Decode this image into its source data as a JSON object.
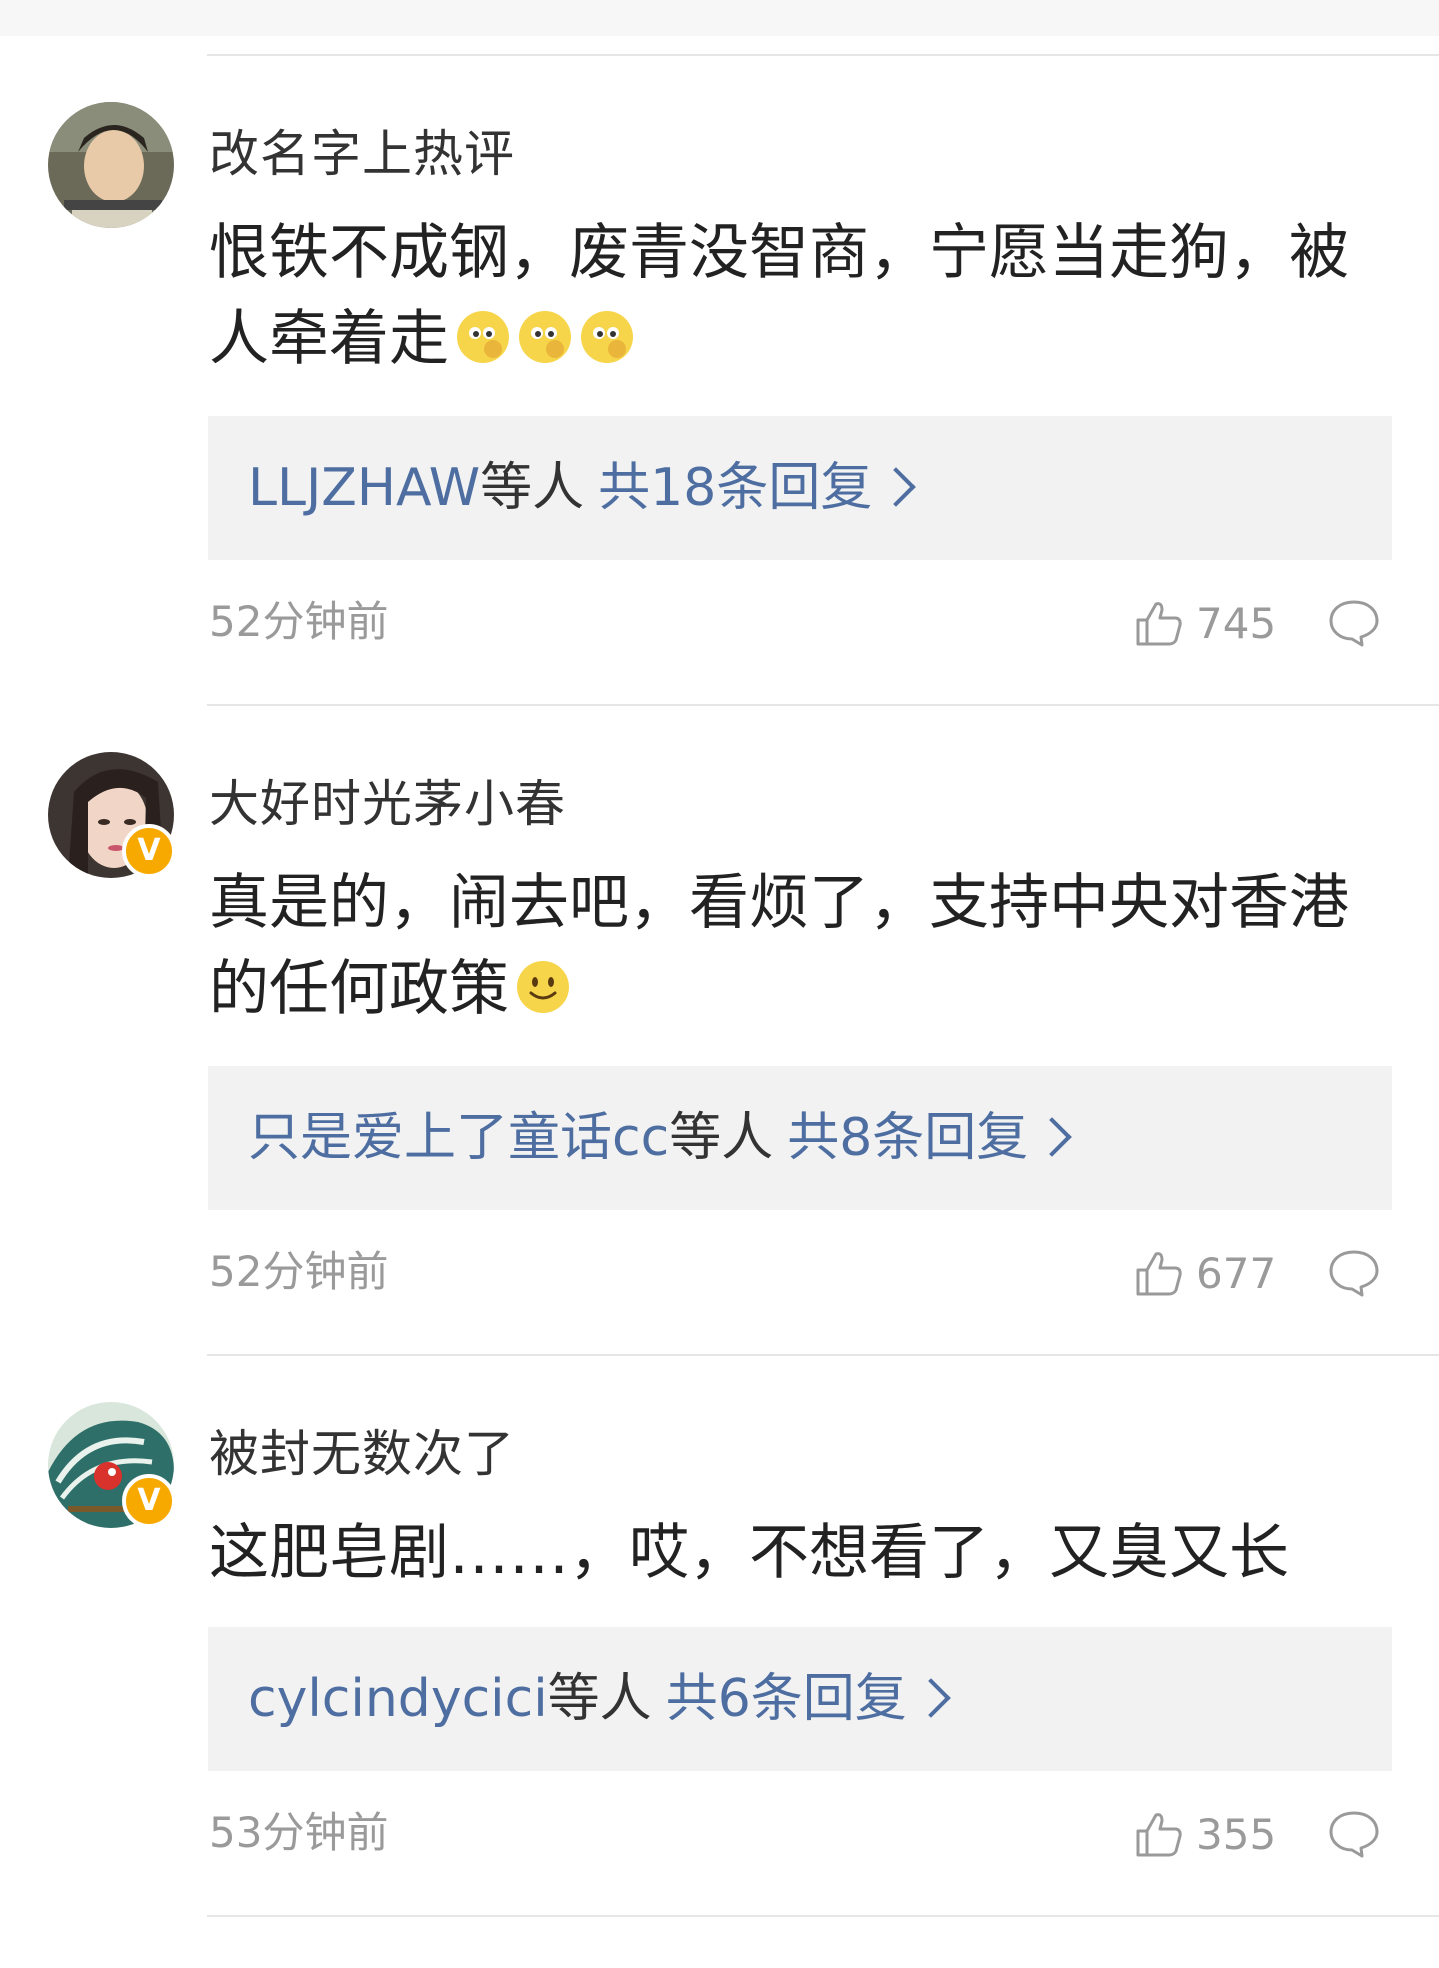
{
  "comments": [
    {
      "username": "改名字上热评",
      "verified": false,
      "text": "恨铁不成钢，废青没智商，宁愿当走狗，被人牵着走",
      "reply_names": "LLJZHAW",
      "reply_suffix": "等人",
      "reply_count": "共18条回复",
      "time": "52分钟前",
      "likes": "745",
      "emoji": [
        "thinking-emoji",
        "thinking-emoji",
        "thinking-emoji"
      ]
    },
    {
      "username": "大好时光茅小春",
      "verified": true,
      "verified_mark": "V",
      "text": "真是的，闹去吧，看烦了，支持中央对香港的任何政策",
      "reply_names": "只是爱上了童话cc",
      "reply_suffix": "等人",
      "reply_count": "共8条回复",
      "time": "52分钟前",
      "likes": "677",
      "emoji": [
        "smile-emoji"
      ]
    },
    {
      "username": "被封无数次了",
      "verified": true,
      "verified_mark": "V",
      "text": "这肥皂剧……，哎，不想看了，又臭又长",
      "reply_names": "cylcindycici",
      "reply_suffix": "等人",
      "reply_count": "共6条回复",
      "time": "53分钟前",
      "likes": "355",
      "emoji": []
    }
  ],
  "colors": {
    "link": "#4e6ea1",
    "meta": "#9a9a9a",
    "reply_bg": "#f2f2f2",
    "verified": "#f7a900"
  },
  "icons": [
    "like-icon",
    "comment-icon",
    "verified-badge"
  ]
}
